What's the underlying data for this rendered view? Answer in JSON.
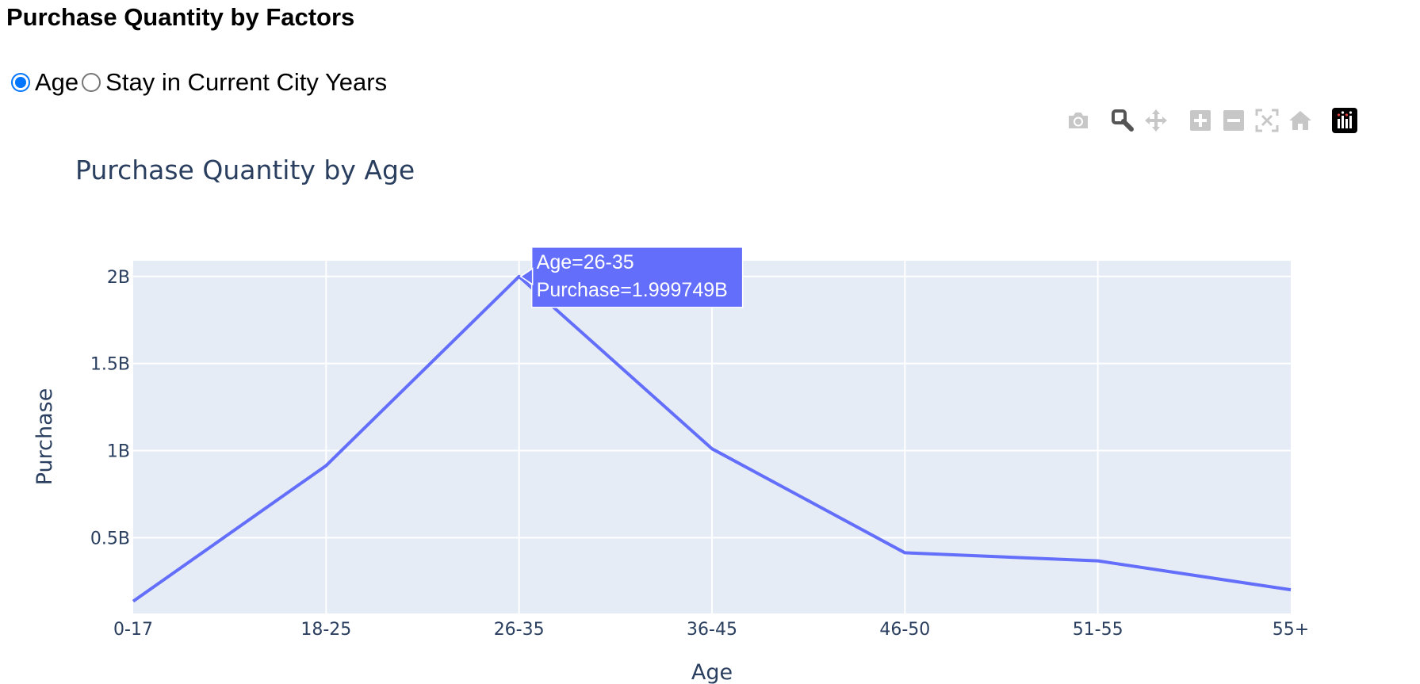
{
  "page": {
    "title": "Purchase Quantity by Factors"
  },
  "radio": {
    "options": [
      {
        "label": "Age",
        "checked": true
      },
      {
        "label": "Stay in Current City Years",
        "checked": false
      }
    ]
  },
  "modebar": {
    "icons": [
      "camera-icon",
      "zoom-icon",
      "pan-icon",
      "zoom-in-icon",
      "zoom-out-icon",
      "autoscale-icon",
      "reset-axes-icon",
      "plotly-logo-icon"
    ]
  },
  "colors": {
    "line": "#636efa",
    "plot_bg": "#e5ecf6",
    "axis_text": "#2a3f5f",
    "grid": "#ffffff"
  },
  "chart_data": {
    "type": "line",
    "title": "Purchase Quantity by Age",
    "xlabel": "Age",
    "ylabel": "Purchase",
    "categories": [
      "0-17",
      "18-25",
      "26-35",
      "36-45",
      "46-50",
      "51-55",
      "55+"
    ],
    "series": [
      {
        "values": [
          134913183,
          913848675,
          1999749106,
          1010649565,
          413418223,
          367099644,
          200767375
        ]
      }
    ],
    "yticks": [
      {
        "value": 500000000,
        "label": "0.5B"
      },
      {
        "value": 1000000000,
        "label": "1B"
      },
      {
        "value": 1500000000,
        "label": "1.5B"
      },
      {
        "value": 2000000000,
        "label": "2B"
      }
    ],
    "ylim": [
      65000000,
      2090000000
    ],
    "grid": true,
    "tooltip": {
      "category": "26-35",
      "line1": "Age=26-35",
      "line2": "Purchase=1.999749B"
    }
  }
}
